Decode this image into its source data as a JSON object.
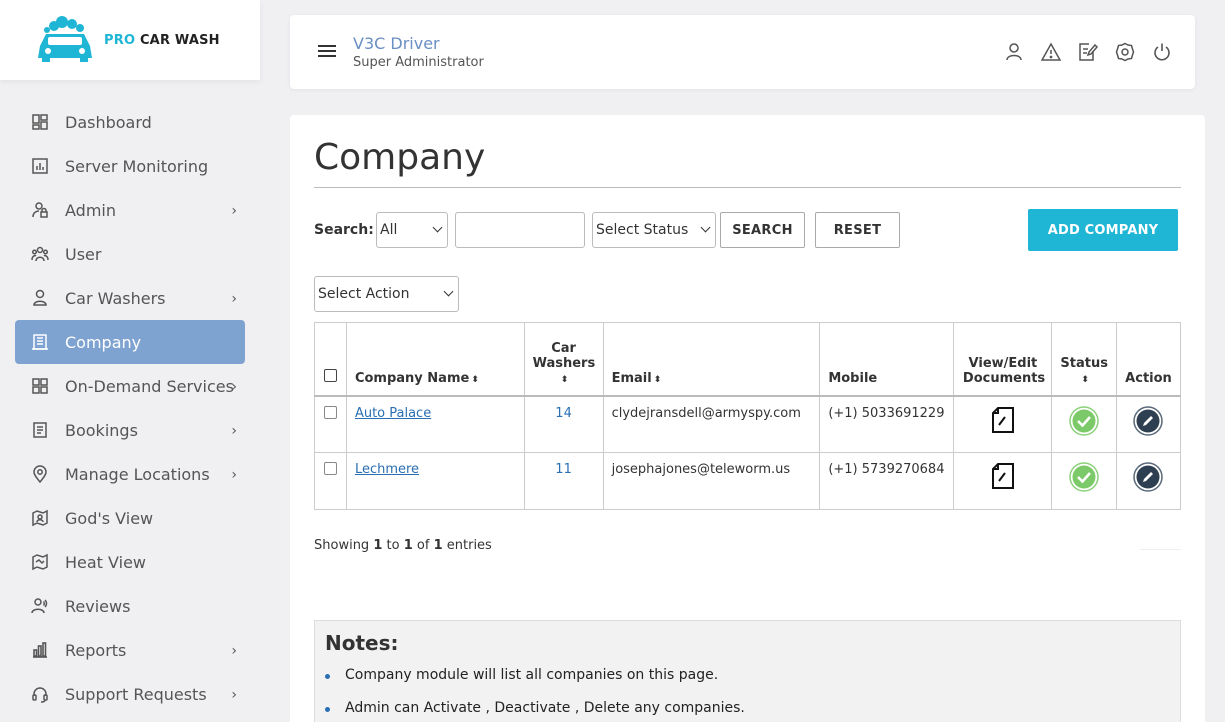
{
  "brand": {
    "pro": "PRO",
    "rest": "CAR WASH",
    "accent": "#1fb6d6"
  },
  "sidebar": {
    "active_color": "#7ea3d1",
    "items": [
      {
        "label": "Dashboard",
        "icon": "dashboard-icon",
        "chevron": false
      },
      {
        "label": "Server Monitoring",
        "icon": "chart-icon",
        "chevron": false
      },
      {
        "label": "Admin",
        "icon": "admin-icon",
        "chevron": true
      },
      {
        "label": "User",
        "icon": "users-icon",
        "chevron": false
      },
      {
        "label": "Car Washers",
        "icon": "person-icon",
        "chevron": true
      },
      {
        "label": "Company",
        "icon": "building-icon",
        "chevron": false,
        "active": true
      },
      {
        "label": "On-Demand Services",
        "icon": "grid-icon",
        "chevron": true
      },
      {
        "label": "Bookings",
        "icon": "document-icon",
        "chevron": true
      },
      {
        "label": "Manage Locations",
        "icon": "location-pin-icon",
        "chevron": true
      },
      {
        "label": "God's View",
        "icon": "map-person-icon",
        "chevron": false
      },
      {
        "label": "Heat View",
        "icon": "map-icon",
        "chevron": false
      },
      {
        "label": "Reviews",
        "icon": "review-icon",
        "chevron": false
      },
      {
        "label": "Reports",
        "icon": "bar-chart-icon",
        "chevron": true
      },
      {
        "label": "Support Requests",
        "icon": "headset-icon",
        "chevron": true
      }
    ]
  },
  "header": {
    "name": "V3C Driver",
    "role": "Super Administrator",
    "icons": [
      "user-icon",
      "warning-icon",
      "edit-note-icon",
      "settings-icon",
      "power-icon"
    ]
  },
  "page": {
    "title": "Company",
    "search_label": "Search:",
    "search_scope": "All",
    "search_value": "",
    "status_select": "Select Status",
    "search_button": "SEARCH",
    "reset_button": "RESET",
    "add_button": "ADD COMPANY",
    "action_select": "Select Action"
  },
  "table": {
    "headers": {
      "company_name": "Company Name",
      "car_washers": "Car Washers",
      "email": "Email",
      "mobile": "Mobile",
      "documents": "View/Edit Documents",
      "status": "Status",
      "action": "Action"
    },
    "rows": [
      {
        "company_name": "Auto Palace",
        "car_washers": "14",
        "email": "clydejransdell@armyspy.com",
        "mobile": "(+1) 5033691229",
        "status": "active"
      },
      {
        "company_name": "Lechmere",
        "car_washers": "11",
        "email": "josephajones@teleworm.us",
        "mobile": "(+1) 5739270684",
        "status": "active"
      }
    ]
  },
  "footer": {
    "showing_prefix": "Showing",
    "from": "1",
    "to_word": "to",
    "to": "1",
    "of_word": "of",
    "total": "1",
    "suffix": "entries"
  },
  "notes": {
    "title": "Notes:",
    "items": [
      "Company module will list all companies on this page.",
      "Admin can Activate , Deactivate , Delete any companies."
    ]
  },
  "colors": {
    "status_active": "#7cc96a",
    "action_button": "#2e3f52",
    "link": "#2a6fb3"
  }
}
